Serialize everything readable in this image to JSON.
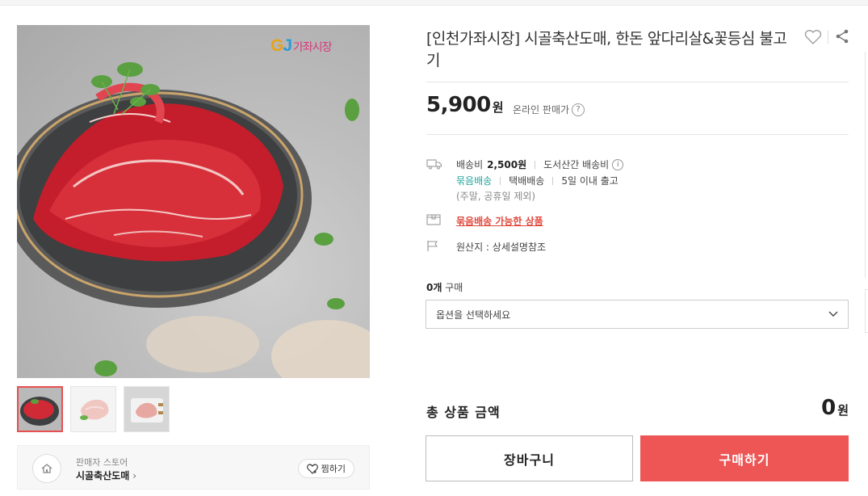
{
  "product": {
    "title": "[인천가좌시장] 시골축산도매, 한돈 앞다리살&꽃등심 불고기",
    "price": "5,900",
    "price_unit": "원",
    "price_label": "온라인 판매가",
    "help_icon": "question-circle-icon"
  },
  "gallery": {
    "logo_g": "G",
    "logo_j": "J",
    "logo_text": "가좌시장",
    "thumbnails": [
      {
        "name": "thumb-1",
        "selected": true
      },
      {
        "name": "thumb-2",
        "selected": false
      },
      {
        "name": "thumb-3",
        "selected": false
      }
    ]
  },
  "seller": {
    "label": "판매자 스토어",
    "name": "시골축산도매",
    "chevron": "›",
    "zzim_label": "찜하기"
  },
  "shipping": {
    "fee_label": "배송비",
    "fee_value": "2,500원",
    "remote_label": "도서산간 배송비",
    "bundle_tag": "묶음배송",
    "method": "택배배송",
    "eta": "5일 이내 출고",
    "note": "(주말, 공휴일 제외)",
    "bundle_link": "묶음배송 가능한 상품",
    "origin": "원산지 : 상세설명참조"
  },
  "order": {
    "qty_count": "0개",
    "qty_label": "구매",
    "option_placeholder": "옵션을 선택하세요",
    "total_label": "총 상품 금액",
    "total_value": "0",
    "total_unit": "원",
    "cart_label": "장바구니",
    "buy_label": "구매하기"
  },
  "colors": {
    "accent_red": "#ee5555",
    "link_red": "#e0483c",
    "teal": "#1fa29a"
  }
}
